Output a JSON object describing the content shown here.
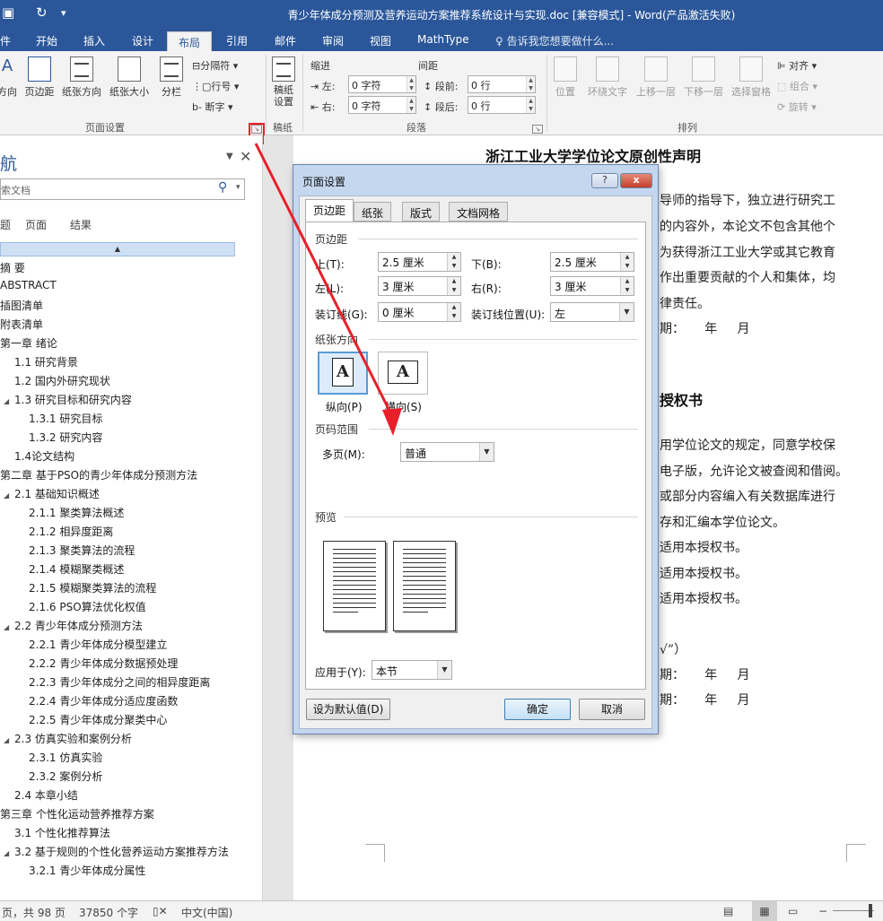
{
  "window": {
    "title": "青少年体成分预测及营养运动方案推荐系统设计与实现.doc [兼容模式] - Word(产品激活失败)"
  },
  "ribbon_tabs": [
    {
      "label": "件"
    },
    {
      "label": "开始"
    },
    {
      "label": "插入"
    },
    {
      "label": "设计"
    },
    {
      "label": "布局",
      "active": true
    },
    {
      "label": "引用"
    },
    {
      "label": "邮件"
    },
    {
      "label": "审阅"
    },
    {
      "label": "视图"
    },
    {
      "label": "MathType"
    }
  ],
  "tell_me": "告诉我您想要做什么...",
  "ribbon": {
    "page_setup": {
      "buttons": [
        "方向",
        "页边距",
        "纸张方向",
        "纸张大小",
        "分栏"
      ],
      "small": [
        "分隔符",
        "行号",
        "断字"
      ],
      "group_label": "页面设置"
    },
    "manuscript": {
      "button": "稿纸\n设置",
      "group_label": "稿纸"
    },
    "paragraph": {
      "indent_label": "缩进",
      "spacing_label": "间距",
      "left_label": "左:",
      "left_value": "0 字符",
      "right_label": "右:",
      "right_value": "0 字符",
      "before_label": "段前:",
      "before_value": "0 行",
      "after_label": "段后:",
      "after_value": "0 行",
      "group_label": "段落"
    },
    "arrange": {
      "buttons": [
        "位置",
        "环绕文字",
        "上移一层",
        "下移一层",
        "选择窗格"
      ],
      "small": [
        "对齐",
        "组合",
        "旋转"
      ],
      "group_label": "排列"
    }
  },
  "nav": {
    "title": "航",
    "search_placeholder": "索文档",
    "tabs": [
      "题",
      "页面",
      "结果"
    ],
    "headings": [
      {
        "text": "摘  要",
        "level": 0
      },
      {
        "text": "ABSTRACT",
        "level": 0
      },
      {
        "text": "插图清单",
        "level": 0
      },
      {
        "text": "附表清单",
        "level": 0
      },
      {
        "text": "第一章 绪论",
        "level": 0
      },
      {
        "text": "1.1 研究背景",
        "level": 1
      },
      {
        "text": "1.2 国内外研究现状",
        "level": 1
      },
      {
        "text": "1.3 研究目标和研究内容",
        "level": 1,
        "expanded": true
      },
      {
        "text": "1.3.1 研究目标",
        "level": 2
      },
      {
        "text": "1.3.2 研究内容",
        "level": 2
      },
      {
        "text": "1.4论文结构",
        "level": 1
      },
      {
        "text": "第二章 基于PSO的青少年体成分预测方法",
        "level": 0
      },
      {
        "text": "2.1 基础知识概述",
        "level": 1,
        "expanded": true
      },
      {
        "text": "2.1.1 聚类算法概述",
        "level": 2
      },
      {
        "text": "2.1.2 相异度距离",
        "level": 2
      },
      {
        "text": "2.1.3 聚类算法的流程",
        "level": 2
      },
      {
        "text": "2.1.4 模糊聚类概述",
        "level": 2
      },
      {
        "text": "2.1.5 模糊聚类算法的流程",
        "level": 2
      },
      {
        "text": "2.1.6  PSO算法优化权值",
        "level": 2
      },
      {
        "text": "2.2 青少年体成分预测方法",
        "level": 1,
        "expanded": true
      },
      {
        "text": "2.2.1 青少年体成分模型建立",
        "level": 2
      },
      {
        "text": "2.2.2 青少年体成分数据预处理",
        "level": 2
      },
      {
        "text": "2.2.3 青少年体成分之间的相异度距离",
        "level": 2
      },
      {
        "text": "2.2.4 青少年体成分适应度函数",
        "level": 2
      },
      {
        "text": "2.2.5 青少年体成分聚类中心",
        "level": 2
      },
      {
        "text": "2.3 仿真实验和案例分析",
        "level": 1,
        "expanded": true
      },
      {
        "text": "2.3.1 仿真实验",
        "level": 2
      },
      {
        "text": "2.3.2 案例分析",
        "level": 2
      },
      {
        "text": "2.4 本章小结",
        "level": 1
      },
      {
        "text": "第三章 个性化运动营养推荐方案",
        "level": 0
      },
      {
        "text": "3.1 个性化推荐算法",
        "level": 1
      },
      {
        "text": "3.2 基于规则的个性化营养运动方案推荐方法",
        "level": 1,
        "expanded": true
      },
      {
        "text": "3.2.1 青少年体成分属性",
        "level": 2
      }
    ]
  },
  "document": {
    "title1": "浙江工业大学学位论文原创性声明",
    "lines1": [
      "导师的指导下，独立进行研究工",
      "的内容外，本论文不包含其他个",
      "为获得浙江工业大学或其它教育",
      "作出重要贡献的个人和集体，均",
      "律责任。",
      "期：     年     月"
    ],
    "title2": "授权书",
    "lines2": [
      "用学位论文的规定，同意学校保",
      "电子版，允许论文被查阅和借阅。",
      "或部分内容编入有关数据库进行",
      "存和汇编本学位论文。",
      "适用本授权书。",
      "适用本授权书。",
      "适用本授权书。",
      "√”）",
      "期：     年     月",
      "期：     年     月"
    ]
  },
  "dialog": {
    "title": "页面设置",
    "help": "?",
    "close": "x",
    "tabs": [
      "页边距",
      "纸张",
      "版式",
      "文档网格"
    ],
    "margins_section": "页边距",
    "top_label": "上(T):",
    "top_value": "2.5 厘米",
    "bottom_label": "下(B):",
    "bottom_value": "2.5 厘米",
    "left_label": "左(L):",
    "left_value": "3 厘米",
    "right_label": "右(R):",
    "right_value": "3 厘米",
    "gutter_label": "装订线(G):",
    "gutter_value": "0 厘米",
    "gutter_pos_label": "装订线位置(U):",
    "gutter_pos_value": "左",
    "orientation_section": "纸张方向",
    "portrait": "纵向(P)",
    "landscape": "横向(S)",
    "pages_section": "页码范围",
    "multiple_label": "多页(M):",
    "multiple_value": "普通",
    "preview_section": "预览",
    "apply_label": "应用于(Y):",
    "apply_value": "本节",
    "default_button": "设为默认值(D)",
    "ok_button": "确定",
    "cancel_button": "取消"
  },
  "status": {
    "page": "页，共 98 页",
    "words": "37850 个字",
    "language": "中文(中国)"
  },
  "colors": {
    "title_bar": "#2b579a",
    "annotation": "#e8202a"
  }
}
